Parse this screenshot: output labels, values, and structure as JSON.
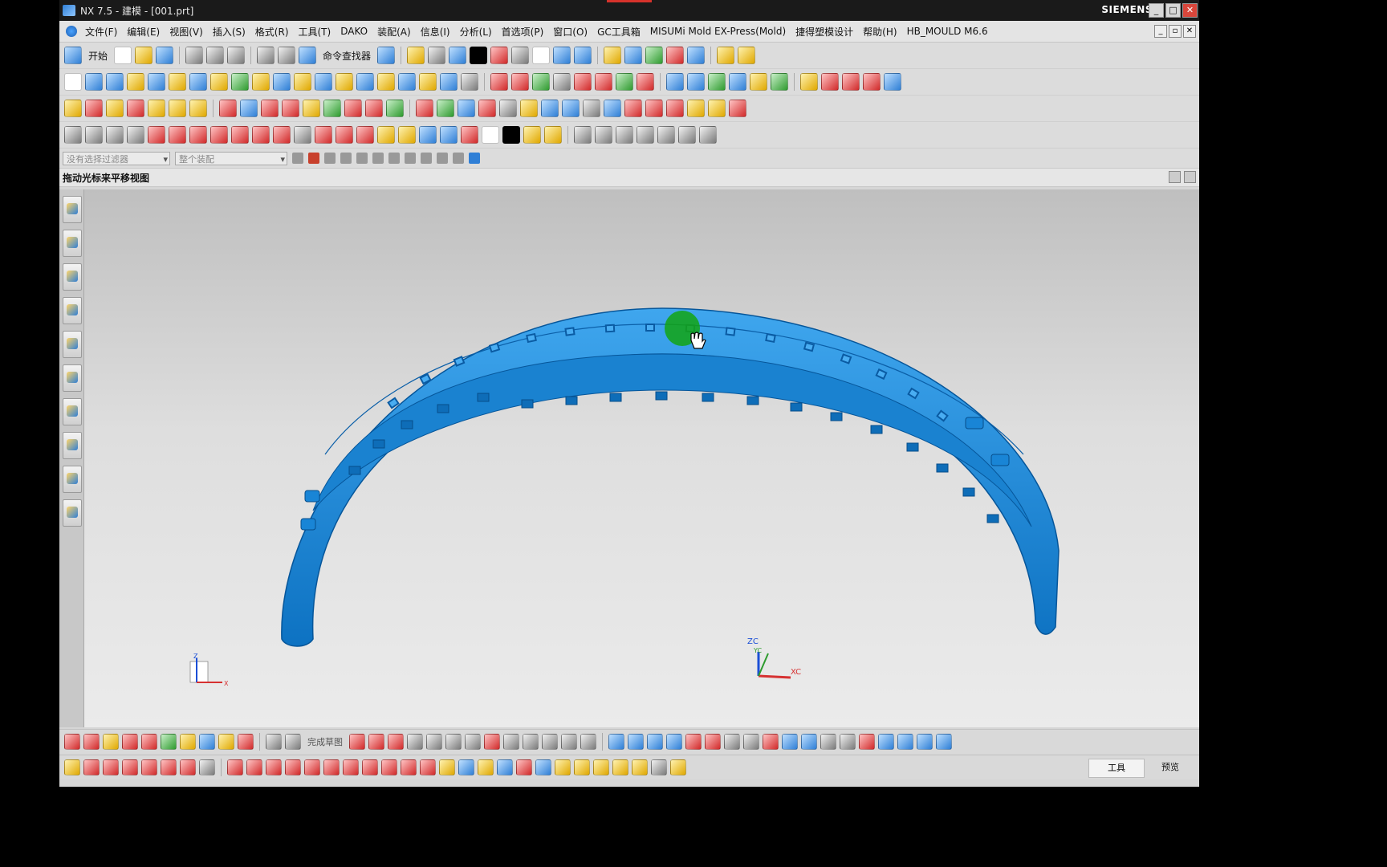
{
  "window": {
    "title": "NX 7.5 - 建模 - [001.prt]",
    "brand": "SIEMENS",
    "controls": {
      "minimize": "_",
      "maximize": "□",
      "close": "✕"
    }
  },
  "menu": {
    "items": [
      "文件(F)",
      "编辑(E)",
      "视图(V)",
      "插入(S)",
      "格式(R)",
      "工具(T)",
      "DAKO",
      "装配(A)",
      "信息(I)",
      "分析(L)",
      "首选项(P)",
      "窗口(O)",
      "GC工具箱",
      "MISUMi Mold EX-Press(Mold)",
      "捷得塑模设计",
      "帮助(H)",
      "HB_MOULD M6.6"
    ]
  },
  "toolbar": {
    "start_label": "开始",
    "command_finder_label": "命令查找器"
  },
  "filter": {
    "selection_filter": "没有选择过滤器",
    "scope": "整个装配"
  },
  "status": {
    "prompt": "拖动光标来平移视图"
  },
  "viewport": {
    "triad_zc": "ZC",
    "triad_yc": "YC",
    "triad_xc": "XC",
    "mini_z": "Z",
    "mini_x": "X",
    "model_color": "#1a8ddb",
    "highlight_color": "#13a413"
  },
  "bottom": {
    "finish_sketch": "完成草图",
    "tools_label": "工具",
    "preview_label": "预览"
  },
  "colors": {
    "titlebar": "#1a1a1a",
    "chrome": "#d6d6d6",
    "accent_red": "#d6322b"
  }
}
